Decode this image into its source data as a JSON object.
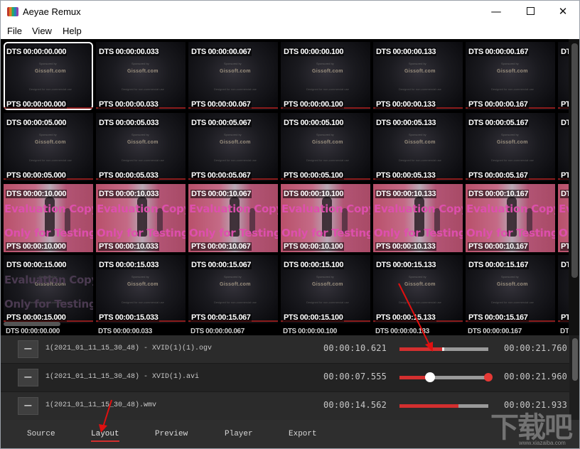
{
  "window": {
    "title": "Aeyae Remux",
    "minimize_glyph": "—",
    "close_glyph": "✕"
  },
  "menu": [
    "File",
    "View",
    "Help"
  ],
  "thumbnails": {
    "rows": [
      {
        "style": "dark",
        "dts": [
          "DTS 00:00:00.000",
          "DTS 00:00:00.033",
          "DTS 00:00:00.067",
          "DTS 00:00:00.100",
          "DTS 00:00:00.133",
          "DTS 00:00:00.167",
          "DTS"
        ],
        "pts": [
          "PTS 00:00:00.000",
          "PTS 00:00:00.033",
          "PTS 00:00:00.067",
          "PTS 00:00:00.100",
          "PTS 00:00:00.133",
          "PTS 00:00:00.167",
          "PTS"
        ]
      },
      {
        "style": "dark",
        "dts": [
          "DTS 00:00:05.000",
          "DTS 00:00:05.033",
          "DTS 00:00:05.067",
          "DTS 00:00:05.100",
          "DTS 00:00:05.133",
          "DTS 00:00:05.167",
          "DTS"
        ],
        "pts": [
          "PTS 00:00:05.000",
          "PTS 00:00:05.033",
          "PTS 00:00:05.067",
          "PTS 00:00:05.100",
          "PTS 00:00:05.133",
          "PTS 00:00:05.167",
          "PTS"
        ]
      },
      {
        "style": "pink",
        "dts": [
          "DTS 00:00:10.000",
          "DTS 00:00:10.033",
          "DTS 00:00:10.067",
          "DTS 00:00:10.100",
          "DTS 00:00:10.133",
          "DTS 00:00:10.167",
          "DTS"
        ],
        "pts": [
          "PTS 00:00:10.000",
          "PTS 00:00:10.033",
          "PTS 00:00:10.067",
          "PTS 00:00:10.100",
          "PTS 00:00:10.133",
          "PTS 00:00:10.167",
          "PTS"
        ]
      },
      {
        "style": "dark",
        "dts": [
          "DTS 00:00:15.000",
          "DTS 00:00:15.033",
          "DTS 00:00:15.067",
          "DTS 00:00:15.100",
          "DTS 00:00:15.133",
          "DTS 00:00:15.167",
          "DTS"
        ],
        "pts": [
          "PTS 00:00:15.000",
          "PTS 00:00:15.033",
          "PTS 00:00:15.067",
          "PTS 00:00:15.100",
          "PTS 00:00:15.133",
          "PTS 00:00:15.167",
          "PTS"
        ]
      }
    ],
    "selected": {
      "row": 0,
      "col": 0
    },
    "logo_text": "Gissoft.com",
    "sponsor_text": "Sponsored by",
    "fineprint_text": "Designed for non-commercial use",
    "eval_line1": "Evaluation Copy",
    "eval_line2": "Only for Testing"
  },
  "tracks": [
    {
      "minus_label": "−",
      "filename": "1(2021_01_11_15_30_48) - XVID(1)(1).ogv",
      "start": "00:00:10.621",
      "end": "00:00:21.760",
      "progress": 0.48,
      "show_knobs": false
    },
    {
      "minus_label": "−",
      "filename": "1(2021_01_11_15_30_48) - XVID(1).avi",
      "start": "00:00:07.555",
      "end": "00:00:21.960",
      "progress": 0.34,
      "show_knobs": true
    },
    {
      "minus_label": "−",
      "filename": "1(2021_01_11_15_30_48).wmv",
      "start": "00:00:14.562",
      "end": "00:00:21.933",
      "progress": 0.66,
      "show_knobs": false
    }
  ],
  "tabs": [
    {
      "label": "Source",
      "active": false
    },
    {
      "label": "Layout",
      "active": true
    },
    {
      "label": "Preview",
      "active": false
    },
    {
      "label": "Player",
      "active": false
    },
    {
      "label": "Export",
      "active": false
    }
  ],
  "watermark": {
    "text": "下载吧",
    "url": "www.xiazaiba.com"
  },
  "colors": {
    "accent": "#d32f2f",
    "panel": "#2b2b2b",
    "eval_text": "#e04fb0",
    "annotation_arrow": "#e01010"
  }
}
